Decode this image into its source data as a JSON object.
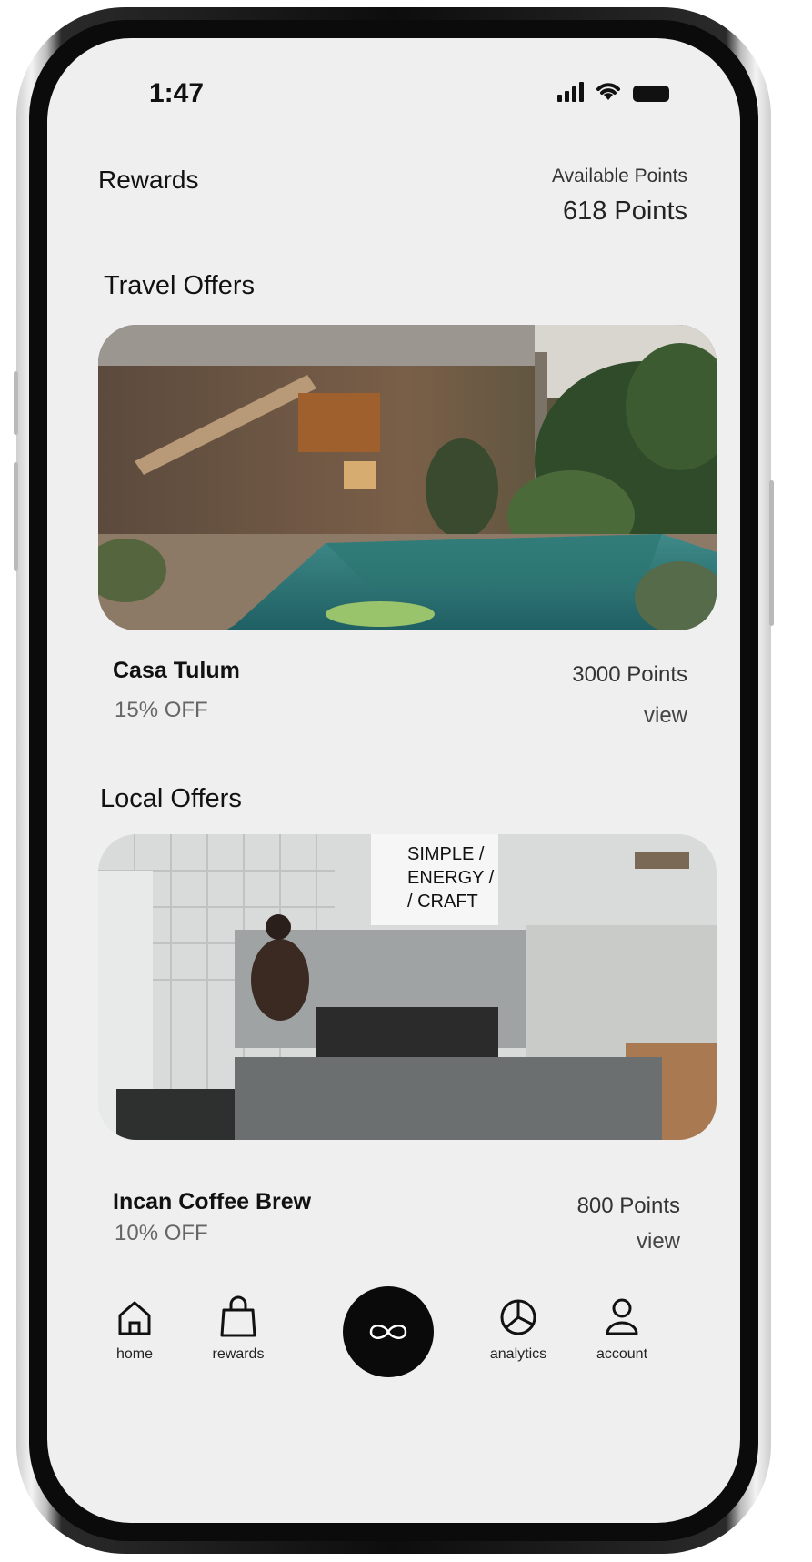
{
  "status_bar": {
    "time": "1:47",
    "signal_icon": "signal-bars-icon",
    "wifi_icon": "wifi-icon",
    "battery_icon": "battery-icon"
  },
  "header": {
    "title": "Rewards",
    "available_label": "Available Points",
    "available_value": "618 Points"
  },
  "travel": {
    "section_title": "Travel Offers",
    "offer": {
      "name": "Casa Tulum",
      "discount": "15% OFF",
      "points": "3000 Points",
      "view_label": "view"
    }
  },
  "local": {
    "section_title": "Local Offers",
    "offer": {
      "name": "Incan Coffee Brew",
      "discount": "10% OFF",
      "points": "800 Points",
      "view_label": "view",
      "sign_text": [
        "SIMPLE /",
        "ENERGY /",
        "/ CRAFT"
      ]
    }
  },
  "tabbar": {
    "items": [
      {
        "label": "home",
        "icon": "home-icon"
      },
      {
        "label": "rewards",
        "icon": "shopping-bag-icon"
      },
      {
        "label": "",
        "icon": "infinity-icon"
      },
      {
        "label": "analytics",
        "icon": "pie-chart-icon"
      },
      {
        "label": "account",
        "icon": "user-icon"
      }
    ]
  },
  "colors": {
    "screen_bg": "#efefef",
    "frame": "#0b0b0b",
    "text_primary": "#111111",
    "text_muted": "#666666",
    "center_button": "#0a0a0a"
  }
}
